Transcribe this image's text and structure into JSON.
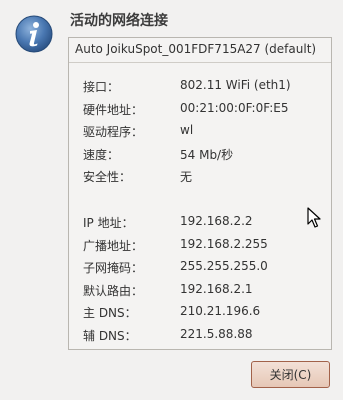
{
  "dialog": {
    "title": "活动的网络连接",
    "connection_name": "Auto JoikuSpot_001FDF715A27 (default)",
    "details": [
      {
        "label": "接口：",
        "value": "802.11 WiFi (eth1)"
      },
      {
        "label": "硬件地址：",
        "value": "00:21:00:0F:0F:E5"
      },
      {
        "label": "驱动程序：",
        "value": "wl"
      },
      {
        "label": "速度：",
        "value": "54 Mb/秒"
      },
      {
        "label": "安全性：",
        "value": "无"
      }
    ],
    "network": [
      {
        "label": "IP 地址：",
        "value": "192.168.2.2"
      },
      {
        "label": "广播地址：",
        "value": "192.168.2.255"
      },
      {
        "label": "子网掩码：",
        "value": "255.255.255.0"
      },
      {
        "label": "默认路由：",
        "value": "192.168.2.1"
      },
      {
        "label": "主 DNS：",
        "value": "210.21.196.6"
      },
      {
        "label": "辅 DNS：",
        "value": "221.5.88.88"
      }
    ],
    "close_label": "关闭(C)",
    "icon": "info-icon",
    "colors": {
      "background": "#f2f1f0",
      "icon_blue": "#3d6fae",
      "button_border": "#a2624a",
      "button_fill": "#ecd3c5"
    }
  }
}
